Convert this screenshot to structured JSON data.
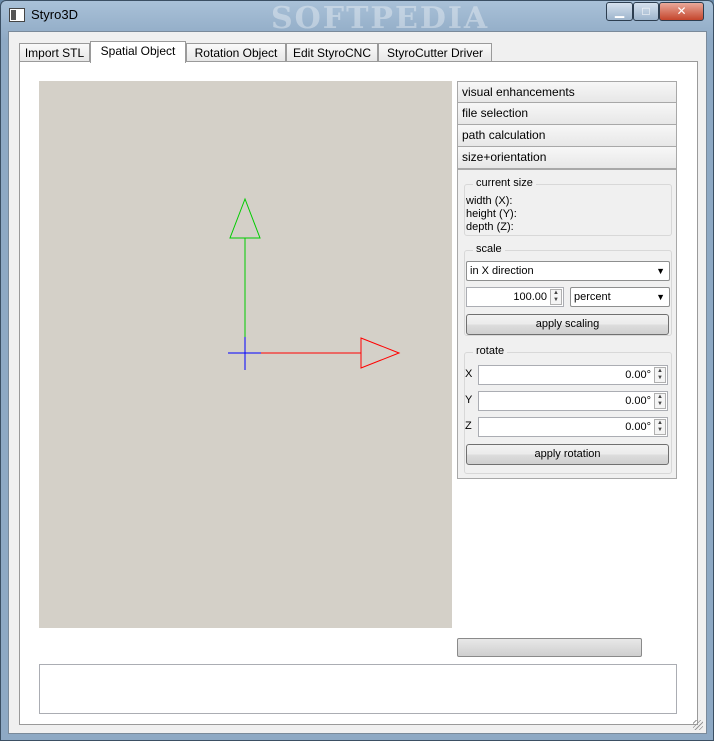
{
  "window": {
    "title": "Styro3D",
    "watermark": "SOFTPEDIA",
    "controls": {
      "minimize": "▁",
      "maximize": "□",
      "close": "✕"
    }
  },
  "tabs": [
    {
      "label": "Import STL",
      "active": false
    },
    {
      "label": "Spatial Object",
      "active": true
    },
    {
      "label": "Rotation Object",
      "active": false
    },
    {
      "label": "Edit StyroCNC",
      "active": false
    },
    {
      "label": "StyroCutter Driver",
      "active": false
    }
  ],
  "toolbox": {
    "sections": [
      "visual enhancements",
      "file selection",
      "path calculation",
      "size+orientation"
    ],
    "current_size": {
      "title": "current size",
      "width_label": "width (X):",
      "height_label": "height (Y):",
      "depth_label": "depth (Z):"
    },
    "scale": {
      "title": "scale",
      "direction": "in X direction",
      "value": "100.00",
      "unit": "percent",
      "apply_label": "apply scaling"
    },
    "rotate": {
      "title": "rotate",
      "x_label": "X",
      "x_value": "0.00°",
      "y_label": "Y",
      "y_value": "0.00°",
      "z_label": "Z",
      "z_value": "0.00°",
      "apply_label": "apply rotation"
    }
  },
  "viewport": {
    "colors": {
      "x_axis": "#ff0000",
      "y_axis": "#00cc00",
      "z_axis": "#0000ff",
      "background": "#d4d0c8"
    }
  },
  "log": {
    "text": ""
  }
}
